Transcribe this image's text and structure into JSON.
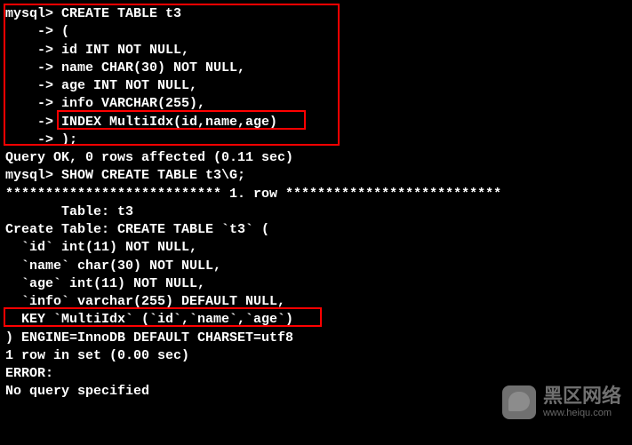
{
  "terminal": {
    "lines": [
      "mysql> CREATE TABLE t3",
      "    -> (",
      "    -> id INT NOT NULL,",
      "    -> name CHAR(30) NOT NULL,",
      "    -> age INT NOT NULL,",
      "    -> info VARCHAR(255),",
      "    -> INDEX MultiIdx(id,name,age)",
      "    -> );",
      "Query OK, 0 rows affected (0.11 sec)",
      "",
      "mysql> SHOW CREATE TABLE t3\\G;",
      "*************************** 1. row ***************************",
      "       Table: t3",
      "Create Table: CREATE TABLE `t3` (",
      "  `id` int(11) NOT NULL,",
      "  `name` char(30) NOT NULL,",
      "  `age` int(11) NOT NULL,",
      "  `info` varchar(255) DEFAULT NULL,",
      "  KEY `MultiIdx` (`id`,`name`,`age`)",
      ") ENGINE=InnoDB DEFAULT CHARSET=utf8",
      "1 row in set (0.00 sec)",
      "",
      "ERROR:",
      "No query specified"
    ]
  },
  "watermark": {
    "title": "黑区网络",
    "url": "www.heiqu.com"
  }
}
